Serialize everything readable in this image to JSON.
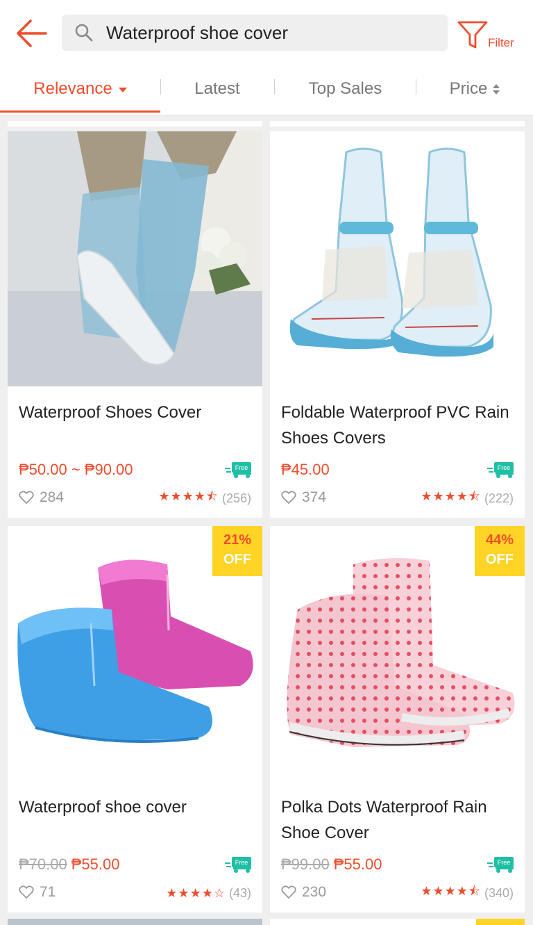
{
  "search": {
    "query": "Waterproof shoe cover"
  },
  "filter": {
    "label": "Filter"
  },
  "tabs": [
    {
      "label": "Relevance"
    },
    {
      "label": "Latest"
    },
    {
      "label": "Top Sales"
    },
    {
      "label": "Price"
    }
  ],
  "products": [
    {
      "title": "Waterproof Shoes Cover",
      "old_price": "",
      "price": "₱50.00 ~ ₱90.00",
      "likes": "284",
      "stars": "★★★★⯪",
      "reviews": "(256)",
      "free_label": "Free",
      "discount": "",
      "off": ""
    },
    {
      "title": "Foldable Waterproof PVC Rain Shoes Covers",
      "old_price": "",
      "price": "₱45.00",
      "likes": "374",
      "stars": "★★★★⯪",
      "reviews": "(222)",
      "free_label": "Free",
      "discount": "",
      "off": ""
    },
    {
      "title": "Waterproof shoe cover",
      "old_price": "₱70.00",
      "price": "₱55.00",
      "likes": "71",
      "stars": "★★★★☆",
      "reviews": "(43)",
      "free_label": "Free",
      "discount": "21%",
      "off": "OFF"
    },
    {
      "title": "Polka Dots Waterproof Rain Shoe Cover",
      "old_price": "₱99.00",
      "price": "₱55.00",
      "likes": "230",
      "stars": "★★★★⯪",
      "reviews": "(340)",
      "free_label": "Free",
      "discount": "44%",
      "off": "OFF"
    }
  ],
  "colors": {
    "accent": "#ee4d2d",
    "free": "#1fbfa4",
    "badge": "#ffd424"
  }
}
